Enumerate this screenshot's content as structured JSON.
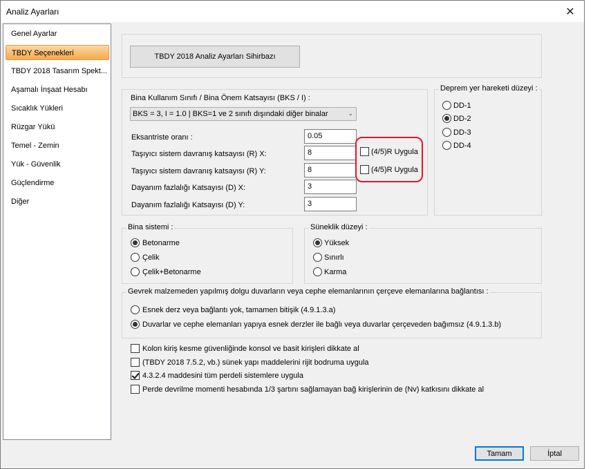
{
  "window": {
    "title": "Analiz Ayarları"
  },
  "sidebar": {
    "items": [
      {
        "label": "Genel Ayarlar"
      },
      {
        "label": "TBDY Seçenekleri"
      },
      {
        "label": "TBDY 2018 Tasarım Spekt..."
      },
      {
        "label": "Aşamalı İnşaat Hesabı"
      },
      {
        "label": "Sıcaklık Yükleri"
      },
      {
        "label": "Rüzgar Yükü"
      },
      {
        "label": "Temel - Zemin"
      },
      {
        "label": "Yük - Güvenlik"
      },
      {
        "label": "Güçlendirme"
      },
      {
        "label": "Diğer"
      }
    ]
  },
  "wizard": {
    "label": "TBDY 2018 Analiz Ayarları Sihirbazı"
  },
  "bks": {
    "group_label": "Bina Kullanım Sınıfı / Bina Önem Katsayısı (BKS / I) :",
    "selected": "BKS = 3, I = 1.0 | BKS=1 ve 2 sınıfı dışındaki diğer binalar"
  },
  "params": {
    "eksantriste_label": "Eksantriste oranı :",
    "eksantriste_value": "0.05",
    "rx_label": "Taşıyıcı sistem davranış katsayısı (R) X:",
    "rx_value": "8",
    "ry_label": "Taşıyıcı sistem davranış katsayısı (R) Y:",
    "ry_value": "8",
    "dx_label": "Dayanım fazlalığı Katsayısı (D) X:",
    "dx_value": "3",
    "dy_label": "Dayanım fazlalığı Katsayısı (D) Y:",
    "dy_value": "3",
    "apply_x_label": "(4/5)R Uygula",
    "apply_y_label": "(4/5)R Uygula"
  },
  "deprem": {
    "group_label": "Deprem yer hareketi düzeyi :",
    "options": [
      "DD-1",
      "DD-2",
      "DD-3",
      "DD-4"
    ]
  },
  "bina_sistemi": {
    "group_label": "Bina sistemi :",
    "options": [
      "Betonarme",
      "Çelik",
      "Çelik+Betonarme"
    ]
  },
  "suneklik": {
    "group_label": "Süneklik düzeyi :",
    "options": [
      "Yüksek",
      "Sınırlı",
      "Karma"
    ]
  },
  "gevrek": {
    "group_label": "Gevrek malzemeden yapılmış dolgu duvarların veya cephe elemanlarının çerçeve elemanlarına bağlantısı :",
    "options": [
      "Esnek derz veya bağlantı yok, tamamen bitişik (4.9.1.3.a)",
      "Duvarlar ve cephe elemanları yapıya esnek derzler ile bağlı veya duvarlar çerçeveden bağımsız (4.9.1.3.b)"
    ]
  },
  "checks": [
    {
      "label": "Kolon kiriş kesme güvenliğinde konsol ve basit kirişleri dikkate al"
    },
    {
      "label": "(TBDY 2018 7.5.2, vb.) sünek yapı maddelerini rijit bodruma uygula"
    },
    {
      "label": "4.3.2.4 maddesini tüm perdeli sistemlere uygula"
    },
    {
      "label": "Perde devrilme momenti hesabında 1/3 şartını sağlamayan bağ kirişlerinin de (Nv) katkısını dikkate al"
    }
  ],
  "footer": {
    "ok_label": "Tamam",
    "cancel_label": "İptal"
  },
  "colors": {
    "highlight": "#e1162b",
    "active_item": "#f6a94b",
    "default_button": "#0078d7"
  }
}
